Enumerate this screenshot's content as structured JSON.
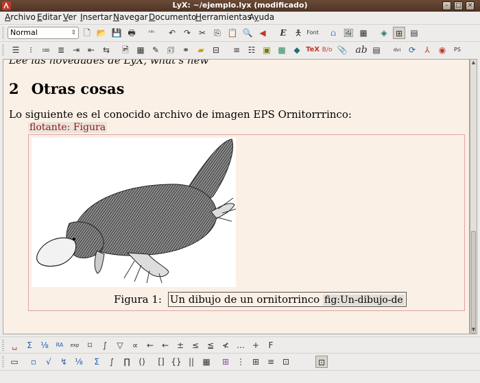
{
  "window": {
    "title": "LyX: ~/ejemplo.lyx (modificado)",
    "controls": [
      "minimize-icon",
      "maximize-icon",
      "close-icon"
    ]
  },
  "menu": [
    {
      "label": "Archivo",
      "mnemonic": "A",
      "rest": "rchivo"
    },
    {
      "label": "Editar",
      "mnemonic": "E",
      "rest": "ditar"
    },
    {
      "label": "Ver",
      "mnemonic": "V",
      "rest": "er"
    },
    {
      "label": "Insertar",
      "mnemonic": "I",
      "rest": "nsertar"
    },
    {
      "label": "Navegar",
      "mnemonic": "N",
      "rest": "avegar"
    },
    {
      "label": "Documento",
      "mnemonic": "D",
      "rest": "ocumento"
    },
    {
      "label": "Herramientas",
      "mnemonic": "H",
      "rest": "erramientas"
    },
    {
      "label": "Ayuda",
      "mnemonic": "y",
      "rest": "uda",
      "prefix": "A"
    }
  ],
  "toolbar": {
    "paragraph_style": "Normal",
    "icons_row1": [
      "new-icon",
      "open-icon",
      "save-icon",
      "print-icon",
      "spellcheck-icon",
      "undo-icon",
      "redo-icon",
      "cut-icon",
      "copy-icon",
      "paste-icon",
      "find-replace-icon",
      "navigate-back-icon",
      "emphasis-icon",
      "noun-icon",
      "font-icon",
      "math-icon",
      "image-icon",
      "table-icon",
      "view-icon",
      "toggle-preview-icon",
      "outline-icon"
    ],
    "icons_row2": [
      "numbered-list-icon",
      "bullet-list-icon",
      "description-icon",
      "enumerate-icon",
      "indent-increase-icon",
      "indent-decrease-icon",
      "insert-graphics-icon",
      "insert-table-icon",
      "footnote-icon",
      "margin-note-icon",
      "cross-ref-icon",
      "label-icon",
      "index-icon",
      "toc-icon",
      "insert-note-icon",
      "tex-icon",
      "bibtex-icon",
      "attach-icon",
      "ab-icon",
      "format-icon",
      "dvi-icon",
      "update-icon",
      "pdf-icon",
      "view-pdf-icon",
      "ps-icon"
    ],
    "symbol_glyphs": {
      "font": "Font",
      "tex": "TeX",
      "ab": "ab",
      "dvi": "dvi",
      "ps": "PS"
    }
  },
  "document": {
    "cut_line": "Lee las novedades de LyX, what's new",
    "section_number": "2",
    "section_title": "Otras cosas",
    "paragraph": "Lo siguiente es el conocido archivo de imagen EPS Ornitorrrinco:",
    "float_label": "flotante: Figura",
    "caption_prefix": "Figura 1:",
    "caption_text": "Un dibujo de un ornitorrinco",
    "caption_label": "fig:Un-dibujo-de"
  },
  "math_toolbar": {
    "row1": [
      "␣",
      "Σ",
      "⅛",
      "RA",
      "exp",
      "⌑",
      "∫",
      "▽",
      "∝",
      "←",
      "←",
      "±",
      "≤",
      "≦",
      "≮",
      "…",
      "+",
      "F"
    ],
    "row2": [
      "▭",
      "▫",
      "√",
      "↯",
      "⅛",
      "Σ",
      "∫",
      "∏",
      "()",
      "[]",
      "{}",
      "||",
      "▦",
      "⊞",
      "⋮",
      "⊞",
      "≡",
      "⊡"
    ]
  }
}
